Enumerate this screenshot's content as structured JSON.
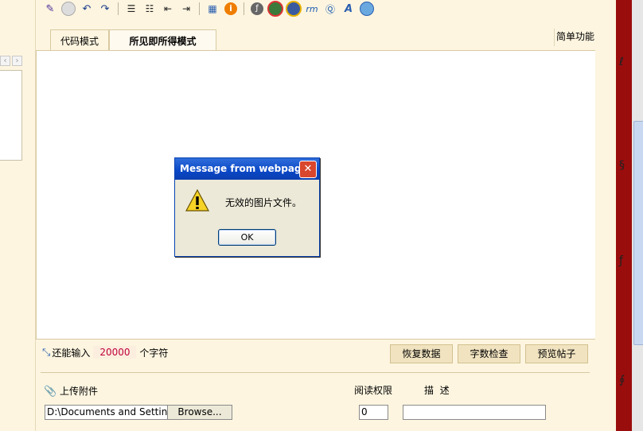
{
  "toolbar": {
    "icons": [
      "quick-edit-icon",
      "emoticon-icon",
      "undo-icon",
      "redo-icon",
      "ordered-list-icon",
      "unordered-list-icon",
      "outdent-icon",
      "indent-icon",
      "table-icon",
      "info-icon",
      "flash-icon",
      "media-player-icon",
      "real-player-icon",
      "wmv-icon",
      "quicktime-icon",
      "font-a-icon",
      "paste-icon"
    ]
  },
  "tabs": [
    {
      "label": "代码模式",
      "active": false
    },
    {
      "label": "所见即所得模式",
      "active": true
    }
  ],
  "simple_function": "简单功能",
  "status": {
    "prefix": "还能输入",
    "count": "20000",
    "suffix": "个字符"
  },
  "buttons": {
    "restore": "恢复数据",
    "word_check": "字数检查",
    "preview": "预览帖子"
  },
  "attachment": {
    "label": "上传附件",
    "file_value": "D:\\Documents and Setting",
    "browse": "Browse...",
    "permission_label": "阅读权限",
    "permission_value": "0",
    "description_label": "描  述",
    "description_value": ""
  },
  "dialog": {
    "title": "Message from webpage",
    "message": "无效的图片文件。",
    "ok": "OK"
  },
  "colors": {
    "counter_text": "#c0003c",
    "page_bg": "#fdf5e0",
    "dialog_title": "#0a47c6"
  }
}
